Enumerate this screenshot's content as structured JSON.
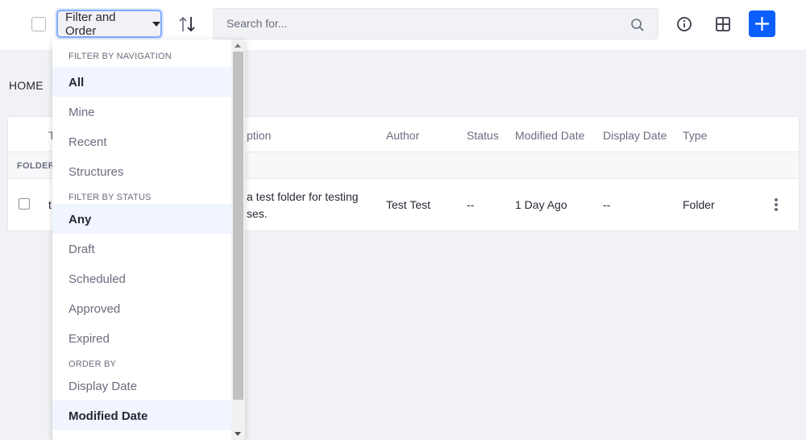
{
  "toolbar": {
    "filter_label": "Filter and Order",
    "search_placeholder": "Search for...",
    "colors": {
      "accent": "#0b5fff",
      "focus_ring": "#80acff"
    },
    "icons": [
      "order-arrows-icon",
      "search-icon",
      "info-icon",
      "cards-icon",
      "plus-icon"
    ]
  },
  "breadcrumb": {
    "home": "HOME"
  },
  "table": {
    "headers": {
      "title": "T",
      "description": "ption",
      "author": "Author",
      "status": "Status",
      "modified": "Modified Date",
      "display": "Display Date",
      "type": "Type"
    },
    "group_label": "FOLDERS",
    "row": {
      "title": "t",
      "description": "a test folder for testing\nses.",
      "author": "Test Test",
      "status": "--",
      "modified": "1 Day Ago",
      "display": "--",
      "type": "Folder"
    }
  },
  "dropdown": {
    "nav_header": "FILTER BY NAVIGATION",
    "nav_items": [
      "All",
      "Mine",
      "Recent",
      "Structures"
    ],
    "status_header": "FILTER BY STATUS",
    "status_items": [
      "Any",
      "Draft",
      "Scheduled",
      "Approved",
      "Expired"
    ],
    "order_header": "ORDER BY",
    "order_items": [
      "Display Date",
      "Modified Date"
    ]
  }
}
